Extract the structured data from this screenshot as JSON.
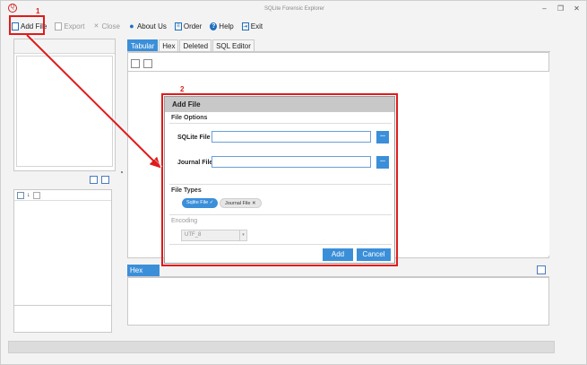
{
  "window": {
    "title": "SQLite Forensic Explorer",
    "controls": [
      "–",
      "❐",
      "✕"
    ]
  },
  "toolbar": {
    "items": [
      {
        "label": "Add File",
        "icon": "file-add-icon"
      },
      {
        "label": "Export",
        "icon": "export-icon"
      },
      {
        "label": "Close",
        "icon": "close-icon"
      },
      {
        "label": "About Us",
        "icon": "person-icon"
      },
      {
        "label": "Order",
        "icon": "order-icon"
      },
      {
        "label": "Help",
        "icon": "help-icon"
      },
      {
        "label": "Exit",
        "icon": "exit-icon"
      }
    ]
  },
  "tabs": [
    "Tabular",
    "Hex",
    "Deleted",
    "SQL Editor"
  ],
  "hex_panel": {
    "label": "Hex"
  },
  "dialog": {
    "title": "Add File",
    "file_options_heading": "File Options",
    "sqlite_file_label": "SQLite File",
    "journal_file_label": "Journal File",
    "browse_label": "...",
    "file_types_heading": "File Types",
    "file_types": [
      {
        "label": "Sqlite File",
        "selected": true
      },
      {
        "label": "Journal File",
        "selected": false
      }
    ],
    "encoding_heading": "Encoding",
    "encoding_value": "UTF_8",
    "add_label": "Add",
    "cancel_label": "Cancel"
  },
  "callouts": {
    "one": "1",
    "two": "2"
  },
  "colors": {
    "accent": "#3b8fd9",
    "callout": "#e01b1b"
  }
}
